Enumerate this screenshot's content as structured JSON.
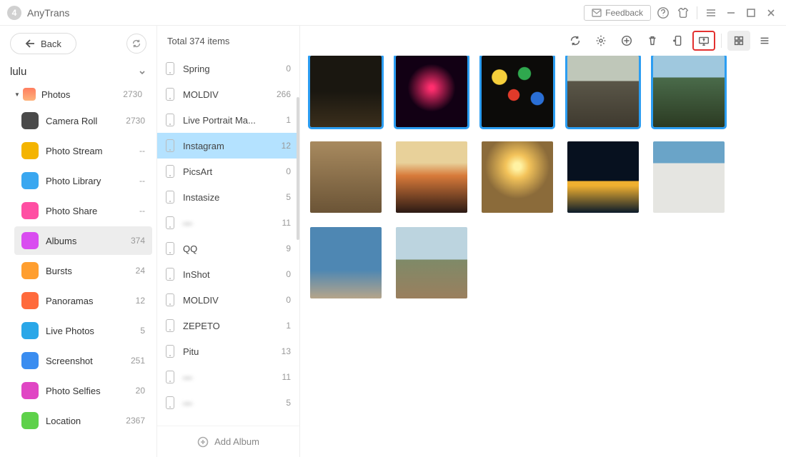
{
  "titlebar": {
    "app": "AnyTrans",
    "feedback": "Feedback"
  },
  "sidebar": {
    "back": "Back",
    "device": "lulu",
    "root": {
      "label": "Photos",
      "count": "2730"
    },
    "items": [
      {
        "label": "Camera Roll",
        "count": "2730",
        "color": "#4a4a4a"
      },
      {
        "label": "Photo Stream",
        "count": "--",
        "color": "#f4b400"
      },
      {
        "label": "Photo Library",
        "count": "--",
        "color": "#3aa7f0"
      },
      {
        "label": "Photo Share",
        "count": "--",
        "color": "#ff4fa3"
      },
      {
        "label": "Albums",
        "count": "374",
        "color": "#d94cf0",
        "selected": true
      },
      {
        "label": "Bursts",
        "count": "24",
        "color": "#ff9e2f"
      },
      {
        "label": "Panoramas",
        "count": "12",
        "color": "#ff6a3c"
      },
      {
        "label": "Live Photos",
        "count": "5",
        "color": "#2aa7e8"
      },
      {
        "label": "Screenshot",
        "count": "251",
        "color": "#3a8df0"
      },
      {
        "label": "Photo Selfies",
        "count": "20",
        "color": "#e046c4"
      },
      {
        "label": "Location",
        "count": "2367",
        "color": "#5ed14a"
      }
    ]
  },
  "mid": {
    "total": "Total 374 items",
    "albums": [
      {
        "label": "Spring",
        "count": "0"
      },
      {
        "label": "MOLDIV",
        "count": "266"
      },
      {
        "label": "Live Portrait Ma...",
        "count": "1"
      },
      {
        "label": "Instagram",
        "count": "12",
        "selected": true
      },
      {
        "label": "PicsArt",
        "count": "0"
      },
      {
        "label": "Instasize",
        "count": "5"
      },
      {
        "label": "—",
        "count": "11",
        "blur": true
      },
      {
        "label": "QQ",
        "count": "9"
      },
      {
        "label": "InShot",
        "count": "0"
      },
      {
        "label": "MOLDIV",
        "count": "0"
      },
      {
        "label": "ZEPETO",
        "count": "1"
      },
      {
        "label": "Pitu",
        "count": "13"
      },
      {
        "label": "—",
        "count": "11",
        "blur": true
      },
      {
        "label": "—",
        "count": "5",
        "blur": true
      }
    ],
    "add": "Add Album"
  },
  "thumbs": [
    {
      "sel": true
    },
    {
      "sel": true
    },
    {
      "sel": true
    },
    {
      "sel": true
    },
    {
      "sel": true
    },
    {
      "sel": false
    },
    {
      "sel": false
    },
    {
      "sel": false
    },
    {
      "sel": false
    },
    {
      "sel": false
    },
    {
      "sel": false
    },
    {
      "sel": false
    }
  ],
  "highlight_tool": "send-to-pc"
}
